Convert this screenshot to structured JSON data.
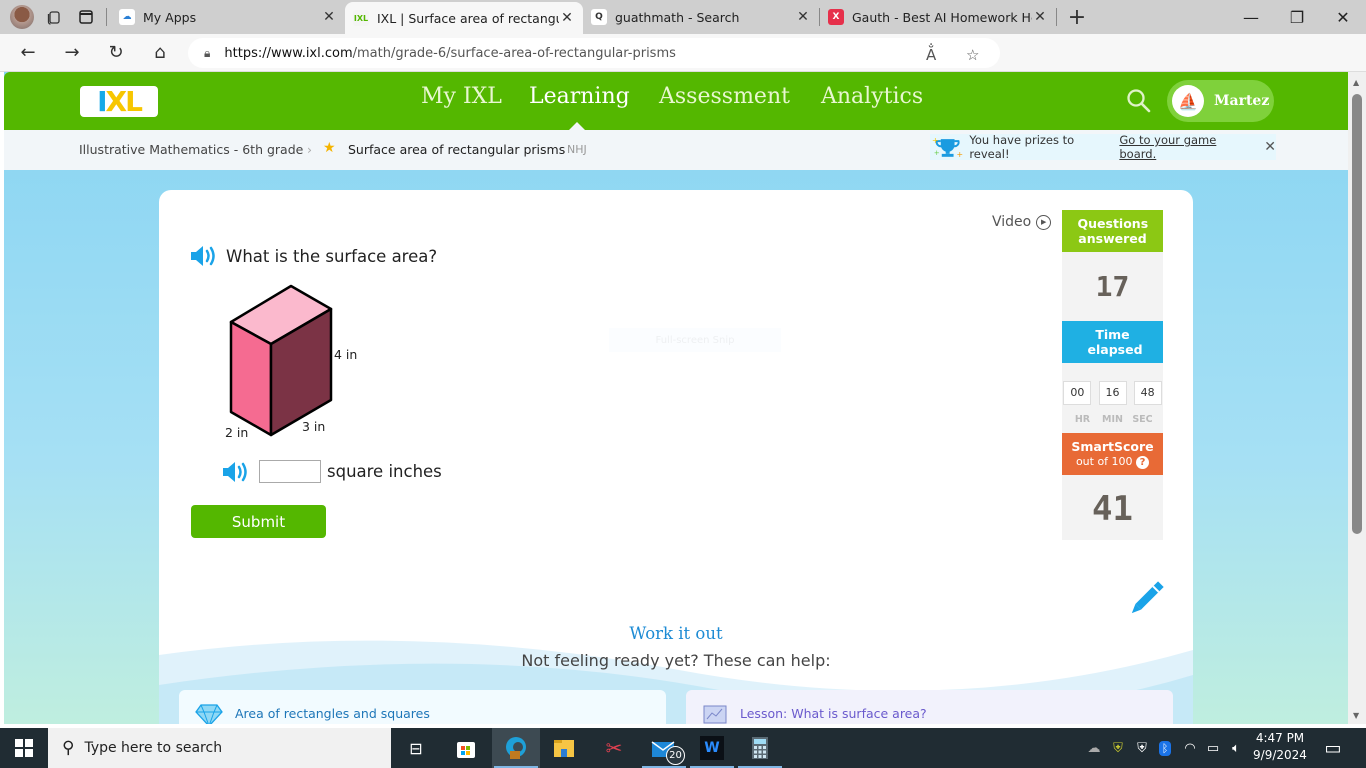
{
  "browser": {
    "tabs": [
      {
        "label": "My Apps",
        "favicon": "my-apps-icon",
        "active": false
      },
      {
        "label": "IXL | Surface area of rectangular p",
        "favicon": "ixl-icon",
        "active": true
      },
      {
        "label": "guathmath - Search",
        "favicon": "search-icon",
        "active": false
      },
      {
        "label": "Gauth - Best AI Homework Helper",
        "favicon": "gauth-icon",
        "active": false
      }
    ],
    "new_tab": "+",
    "url_host": "https://www.ixl.com",
    "url_path": "/math/grade-6/surface-area-of-rectangular-prisms",
    "more_label": "···"
  },
  "ixl": {
    "logo": {
      "i": "I",
      "xl": "XL"
    },
    "nav": [
      {
        "label": "My IXL",
        "active": false
      },
      {
        "label": "Learning",
        "active": true
      },
      {
        "label": "Assessment",
        "active": false
      },
      {
        "label": "Analytics",
        "active": false
      }
    ],
    "user_name": "Martez",
    "breadcrumb": {
      "parent": "Illustrative Mathematics - 6th grade",
      "current": "Surface area of rectangular prisms",
      "code": "NHJ"
    },
    "prize": {
      "text": "You have prizes to reveal!",
      "link": "Go to your game board."
    }
  },
  "question": {
    "prompt": "What is the surface area?",
    "dimensions": {
      "height": "4 in",
      "depth": "2 in",
      "width": "3 in"
    },
    "answer_value": "",
    "answer_unit": "square inches",
    "submit_label": "Submit",
    "video_label": "Video",
    "snip_overlay": "Full-screen Snip"
  },
  "stats": {
    "questions_header": "Questions answered",
    "questions_answered": "17",
    "time_header": "Time elapsed",
    "time": {
      "hr": "00",
      "min": "16",
      "sec": "48"
    },
    "time_labels": {
      "hr": "HR",
      "min": "MIN",
      "sec": "SEC"
    },
    "smartscore_header": "SmartScore",
    "smartscore_sub": "out of 100",
    "smartscore": "41"
  },
  "help": {
    "title": "Work it out",
    "subtitle": "Not feeling ready yet? These can help:",
    "cards": [
      {
        "label": "Area of rectangles and squares",
        "icon": "diamond-icon"
      },
      {
        "label": "Lesson: What is surface area?",
        "icon": "lesson-icon"
      }
    ]
  },
  "colors": {
    "ixl_green": "#54b700",
    "questions_green": "#8cc814",
    "time_blue": "#1fb0e3",
    "smartscore_orange": "#e86a36",
    "prism_top": "#fbb9cd",
    "prism_front": "#f56b91",
    "prism_side": "#7b3345"
  },
  "taskbar": {
    "search_placeholder": "Type here to search",
    "mail_badge": "20",
    "time": "4:47 PM",
    "date": "9/9/2024"
  }
}
